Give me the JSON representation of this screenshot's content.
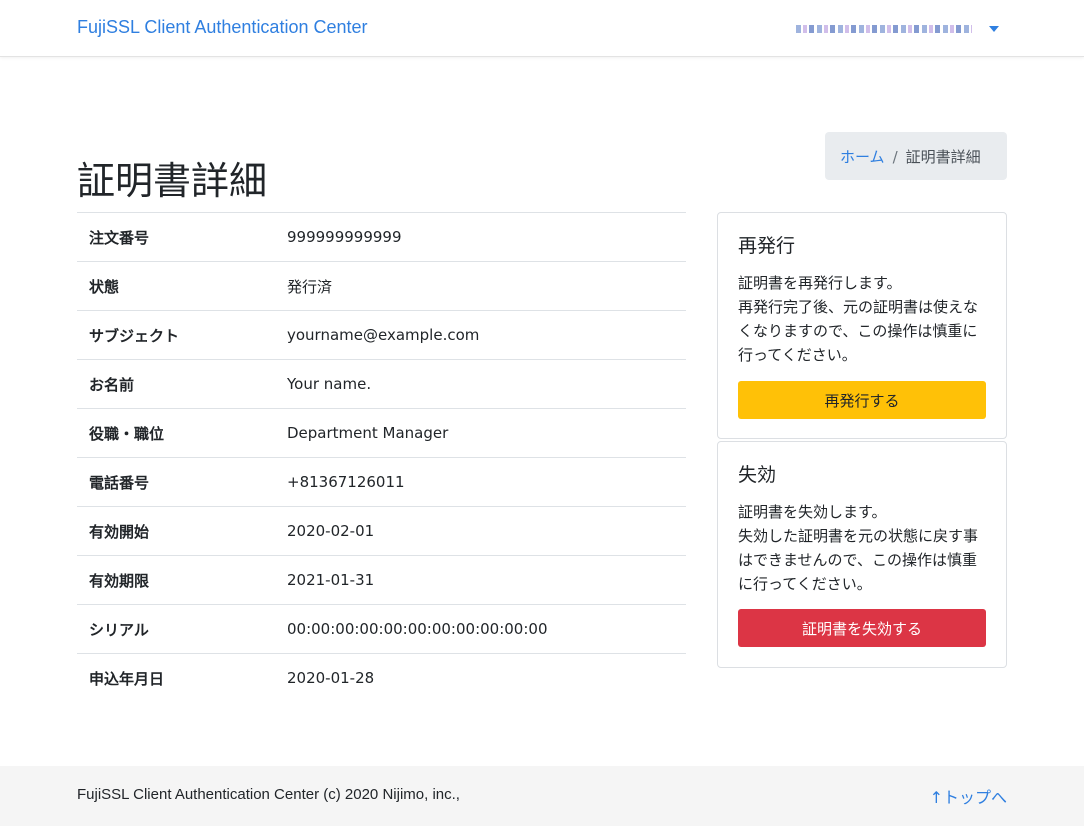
{
  "navbar": {
    "brand": "FujiSSL Client Authentication Center"
  },
  "breadcrumb": {
    "home": "ホーム",
    "separator": "/",
    "current": "証明書詳細"
  },
  "page": {
    "title": "証明書詳細"
  },
  "details": [
    {
      "label": "注文番号",
      "value": "999999999999"
    },
    {
      "label": "状態",
      "value": "発行済"
    },
    {
      "label": "サブジェクト",
      "value": "yourname@example.com"
    },
    {
      "label": "お名前",
      "value": "Your name."
    },
    {
      "label": "役職・職位",
      "value": "Department Manager"
    },
    {
      "label": "電話番号",
      "value": "+81367126011"
    },
    {
      "label": "有効開始",
      "value": "2020-02-01"
    },
    {
      "label": "有効期限",
      "value": "2021-01-31"
    },
    {
      "label": "シリアル",
      "value": "00:00:00:00:00:00:00:00:00:00:00"
    },
    {
      "label": "申込年月日",
      "value": "2020-01-28"
    }
  ],
  "reissue": {
    "title": "再発行",
    "line1": "証明書を再発行します。",
    "line2": "再発行完了後、元の証明書は使えなくなりますので、この操作は慎重に行ってください。",
    "button": "再発行する"
  },
  "revoke": {
    "title": "失効",
    "line1": "証明書を失効します。",
    "line2": "失効した証明書を元の状態に戻す事はできませんので、この操作は慎重に行ってください。",
    "button": "証明書を失効する"
  },
  "footer": {
    "copyright": "FujiSSL Client Authentication Center (c) 2020 Nijimo, inc.,",
    "top_link": "↑トップへ"
  },
  "colors": {
    "link": "#2f7fe0",
    "warning": "#ffc107",
    "danger": "#dc3545"
  },
  "icons": {
    "user_menu_caret": "caret-down-icon"
  }
}
